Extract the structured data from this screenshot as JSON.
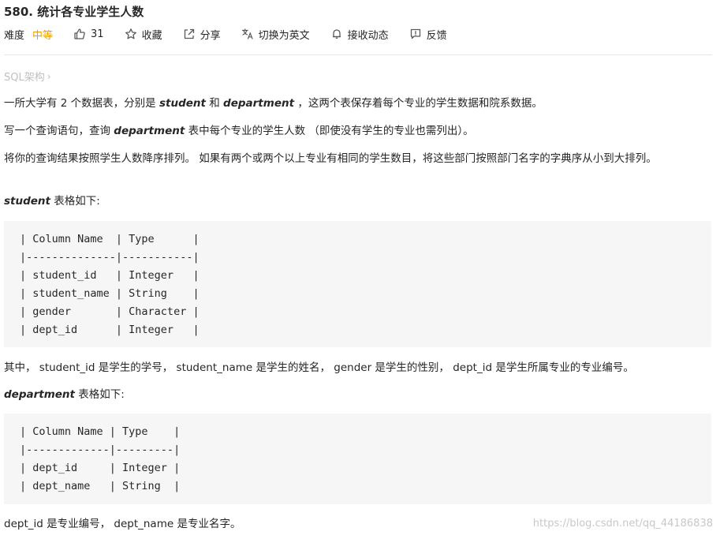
{
  "problem": {
    "title": "580. 统计各专业学生人数"
  },
  "toolbar": {
    "difficulty_label": "难度",
    "difficulty_value": "中等",
    "likes": "31",
    "favorite_label": "收藏",
    "share_label": "分享",
    "translate_label": "切换为英文",
    "notify_label": "接收动态",
    "feedback_label": "反馈"
  },
  "breadcrumb": {
    "label": "SQL架构",
    "chevron": "›"
  },
  "description": {
    "p1_a": "一所大学有 2 个数据表，分别是 ",
    "p1_student": "student",
    "p1_b": " 和 ",
    "p1_department": "department",
    "p1_c": " ，这两个表保存着每个专业的学生数据和院系数据。",
    "p2_a": "写一个查询语句，查询 ",
    "p2_department": "department",
    "p2_b": " 表中每个专业的学生人数 （即使没有学生的专业也需列出）。",
    "p3": "将你的查询结果按照学生人数降序排列。 如果有两个或两个以上专业有相同的学生数目，将这些部门按照部门名字的字典序从小到大排列。",
    "student_heading_em": "student",
    "student_heading_rest": " 表格如下:",
    "student_table_lines": [
      "| Column Name  | Type      |",
      "|--------------|-----------|",
      "| student_id   | Integer   |",
      "| student_name | String    |",
      "| gender       | Character |",
      "| dept_id      | Integer   |"
    ],
    "p4": "其中， student_id 是学生的学号， student_name 是学生的姓名， gender 是学生的性别， dept_id 是学生所属专业的专业编号。",
    "department_heading_em": "department",
    "department_heading_rest": " 表格如下:",
    "department_table_lines": [
      "| Column Name | Type    |",
      "|-------------|---------|",
      "| dept_id     | Integer |",
      "| dept_name   | String  |"
    ],
    "p5": "dept_id 是专业编号， dept_name 是专业名字。"
  },
  "watermark": "https://blog.csdn.net/qq_44186838",
  "icons": {
    "like": "thumbs-up-icon",
    "favorite": "star-icon",
    "share": "share-icon",
    "translate": "translate-icon",
    "notify": "bell-icon",
    "feedback": "feedback-icon"
  },
  "colors": {
    "difficulty_medium": "#ef9c00",
    "code_background": "#f6f6f6",
    "muted_text": "#bfbfbf"
  }
}
